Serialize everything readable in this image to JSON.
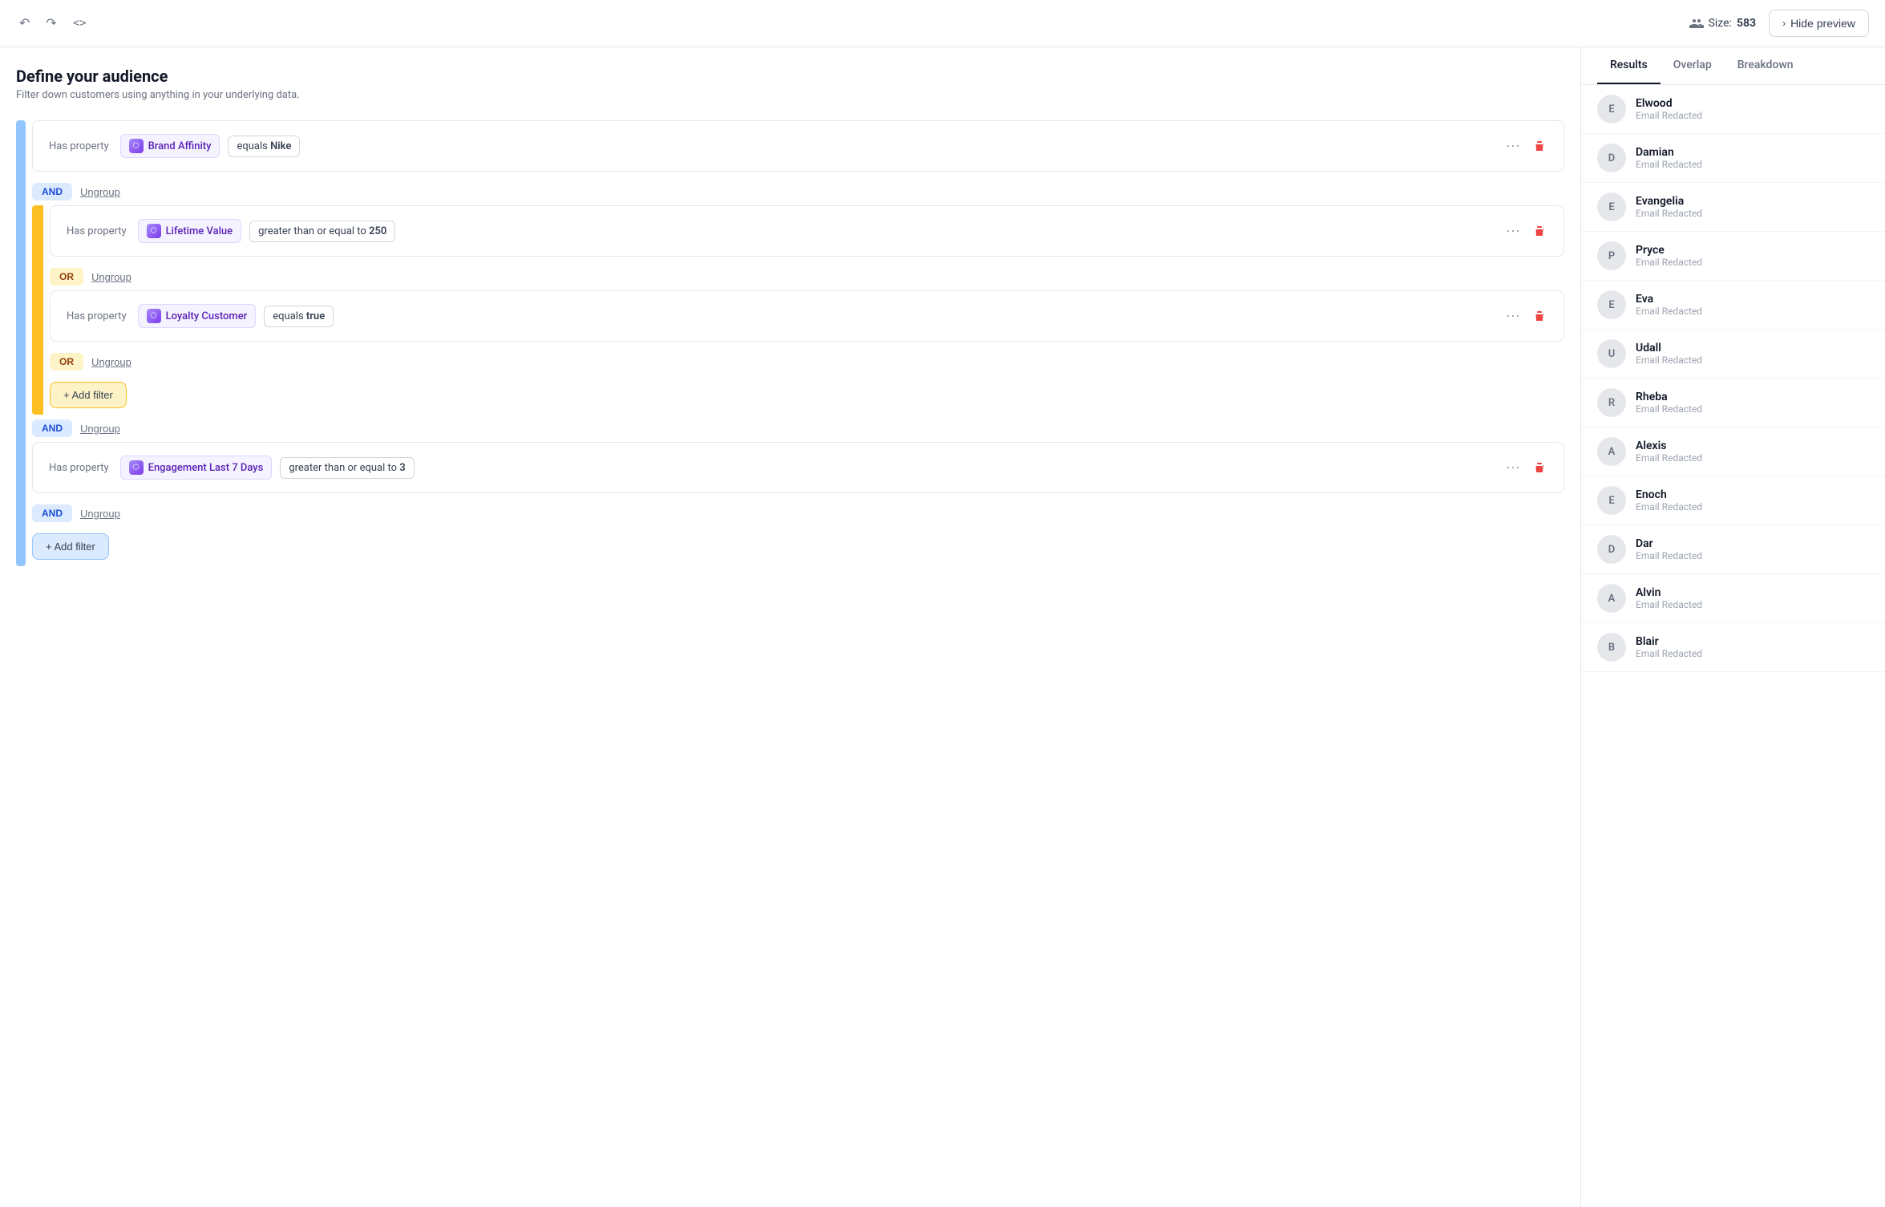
{
  "topBar": {
    "sizeLabel": "Size:",
    "sizeCount": "583",
    "hidePreviewLabel": "Hide preview"
  },
  "page": {
    "title": "Define your audience",
    "subtitle": "Filter down customers using anything in your underlying data."
  },
  "tabs": {
    "results": "Results",
    "overlap": "Overlap",
    "breakdown": "Breakdown",
    "activeTab": "results"
  },
  "filters": {
    "hasProperty": "Has property",
    "filter1": {
      "property": "Brand Affinity",
      "condition": "equals",
      "value": "Nike"
    },
    "filter2": {
      "property": "Lifetime Value",
      "condition": "greater than or equal to",
      "value": "250"
    },
    "filter3": {
      "property": "Loyalty Customer",
      "condition": "equals",
      "value": "true"
    },
    "filter4": {
      "property": "Engagement Last 7 Days",
      "condition": "greater than or equal to",
      "value": "3"
    }
  },
  "buttons": {
    "and": "AND",
    "or": "OR",
    "ungroup": "Ungroup",
    "addFilter": "+ Add filter"
  },
  "results": [
    {
      "initial": "E",
      "name": "Elwood",
      "email": "Email Redacted"
    },
    {
      "initial": "D",
      "name": "Damian",
      "email": "Email Redacted"
    },
    {
      "initial": "E",
      "name": "Evangelia",
      "email": "Email Redacted"
    },
    {
      "initial": "P",
      "name": "Pryce",
      "email": "Email Redacted"
    },
    {
      "initial": "E",
      "name": "Eva",
      "email": "Email Redacted"
    },
    {
      "initial": "U",
      "name": "Udall",
      "email": "Email Redacted"
    },
    {
      "initial": "R",
      "name": "Rheba",
      "email": "Email Redacted"
    },
    {
      "initial": "A",
      "name": "Alexis",
      "email": "Email Redacted"
    },
    {
      "initial": "E",
      "name": "Enoch",
      "email": "Email Redacted"
    },
    {
      "initial": "D",
      "name": "Dar",
      "email": "Email Redacted"
    },
    {
      "initial": "A",
      "name": "Alvin",
      "email": "Email Redacted"
    },
    {
      "initial": "B",
      "name": "Blair",
      "email": "Email Redacted"
    }
  ]
}
